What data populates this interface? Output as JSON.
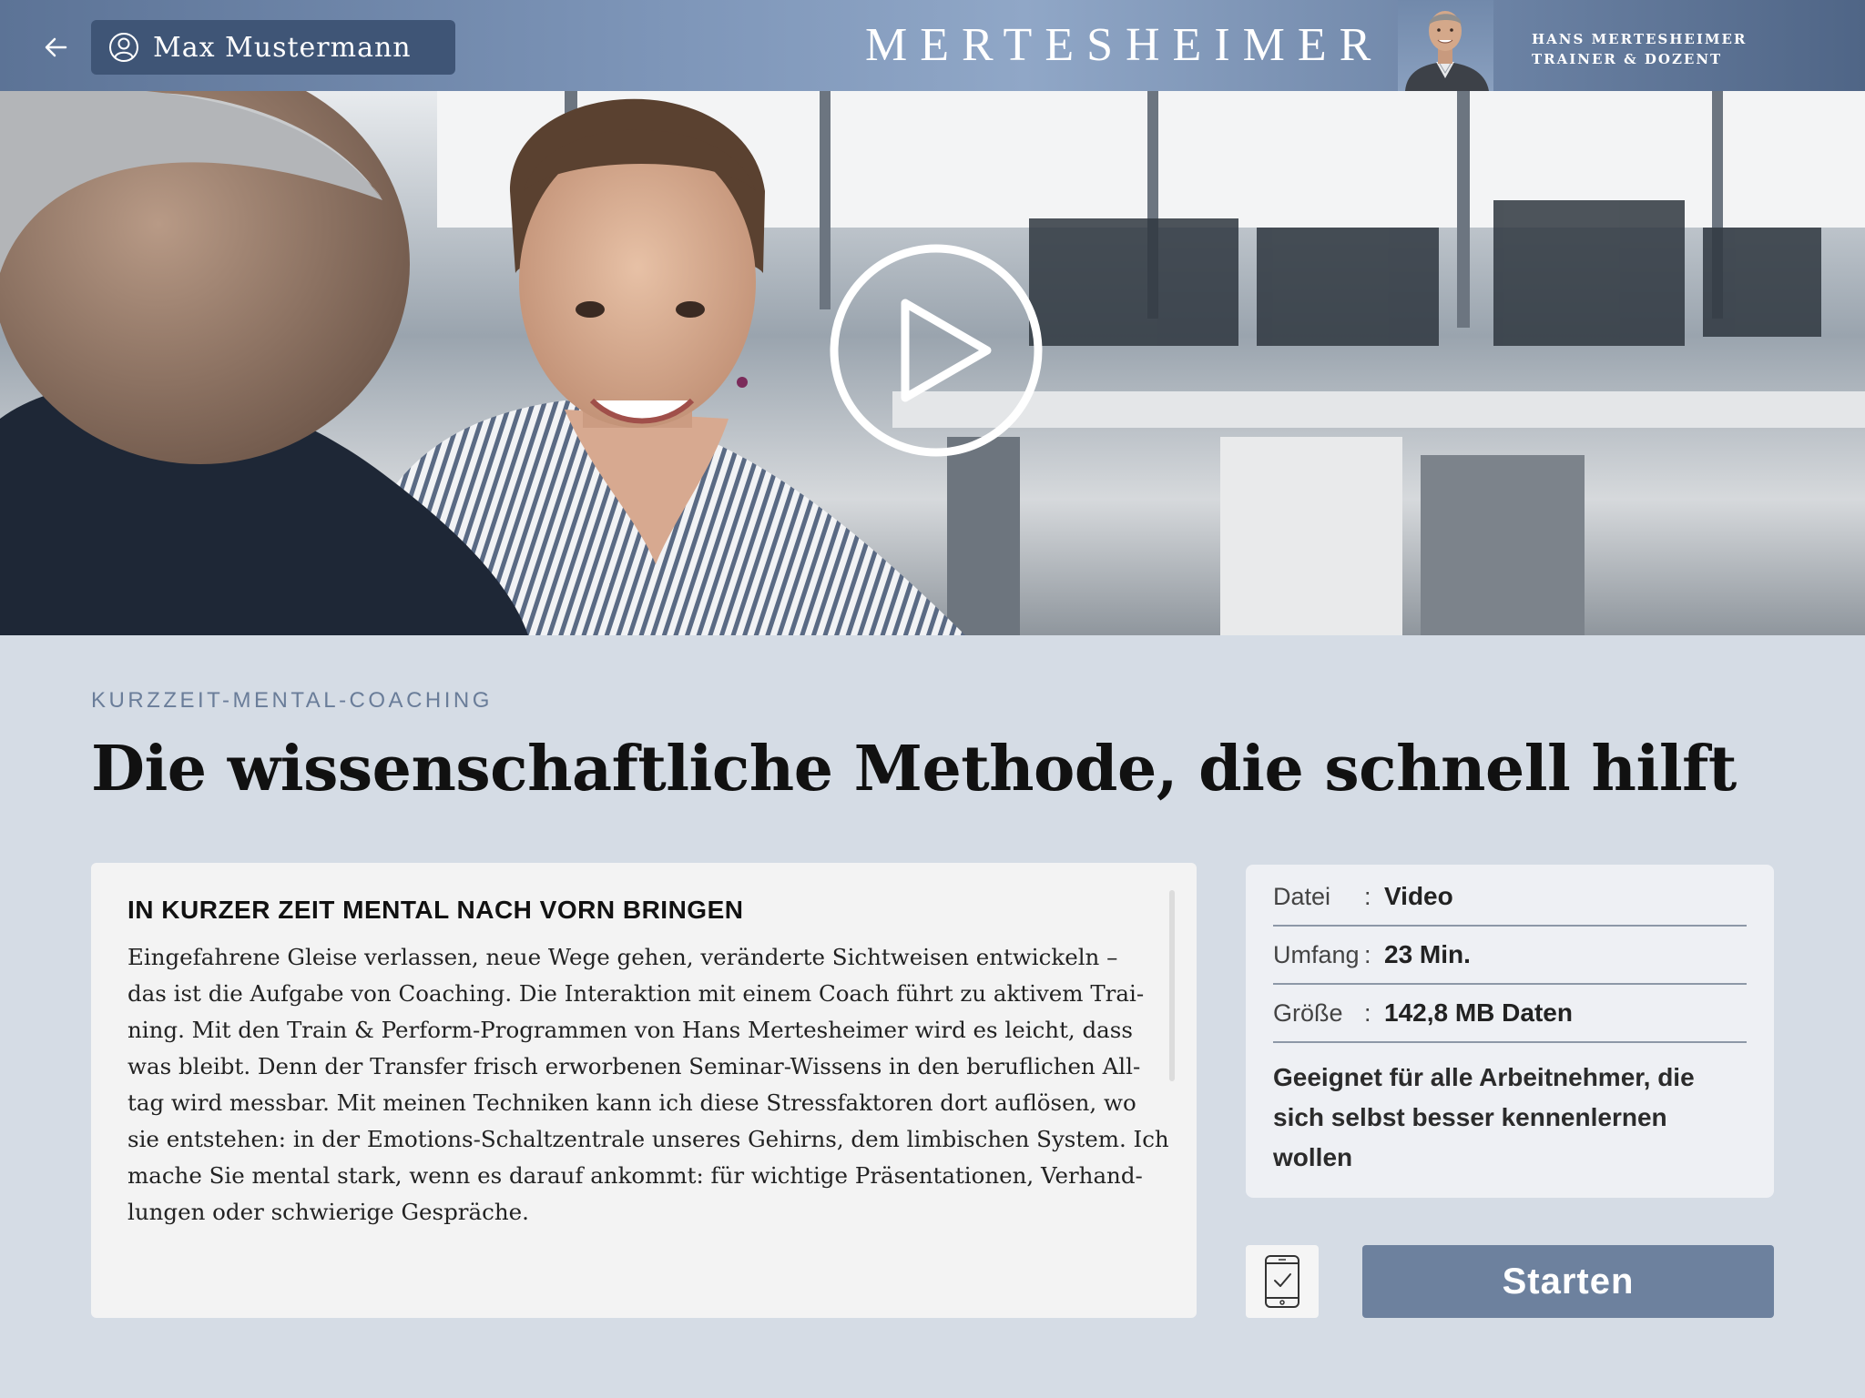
{
  "header": {
    "back_icon": "arrow-left-icon",
    "user_icon": "user-circle-icon",
    "user_name": "Max Mustermann",
    "brand": "MERTESHEIMER",
    "trainer_name": "HANS MERTESHEIMER",
    "trainer_role": "TRAINER & DOZENT"
  },
  "hero": {
    "play_icon": "play-circle-icon"
  },
  "content": {
    "eyebrow": "KURZZEIT-MENTAL-COACHING",
    "title": "Die wissenschaftliche Methode, die schnell hilft",
    "description": {
      "heading": "IN KURZER ZEIT MENTAL NACH VORN BRINGEN",
      "lines": [
        "Eingefahrene Gleise verlassen, neue Wege gehen, veränderte Sichtweisen entwickeln –",
        "das ist die Aufgabe von Coaching. Die Interaktion mit einem Coach führt zu aktivem Trai-",
        "ning. Mit den Train & Perform-Programmen von Hans Mertesheimer wird es leicht, dass",
        "was bleibt. Denn der Transfer frisch erworbenen Seminar-Wissens in den beruflichen All-",
        "tag wird messbar. Mit meinen Techniken kann ich diese Stressfaktoren dort auflösen, wo",
        "sie entstehen: in der Emotions-Schaltzentrale unseres Gehirns, dem limbischen System. Ich",
        "mache Sie mental stark, wenn es darauf ankommt: für wichtige  Präsentationen, Verhand-",
        "lungen oder schwierige Gespräche."
      ]
    },
    "meta": {
      "rows": [
        {
          "key": "Datei",
          "colon": ":",
          "value": "Video"
        },
        {
          "key": "Umfang",
          "colon": ":",
          "value": "23 Min."
        },
        {
          "key": "Größe",
          "colon": ":",
          "value": "142,8 MB Daten"
        }
      ],
      "note": "Geeignet für alle Arbeitnehmer, die sich selbst besser kennenlernen wollen"
    },
    "actions": {
      "device_icon": "smartphone-check-icon",
      "start_label": "Starten"
    }
  },
  "colors": {
    "accent": "#6d819e",
    "header_dark": "#3f5576",
    "background": "#d5dce5",
    "eyebrow": "#6a7d99"
  }
}
